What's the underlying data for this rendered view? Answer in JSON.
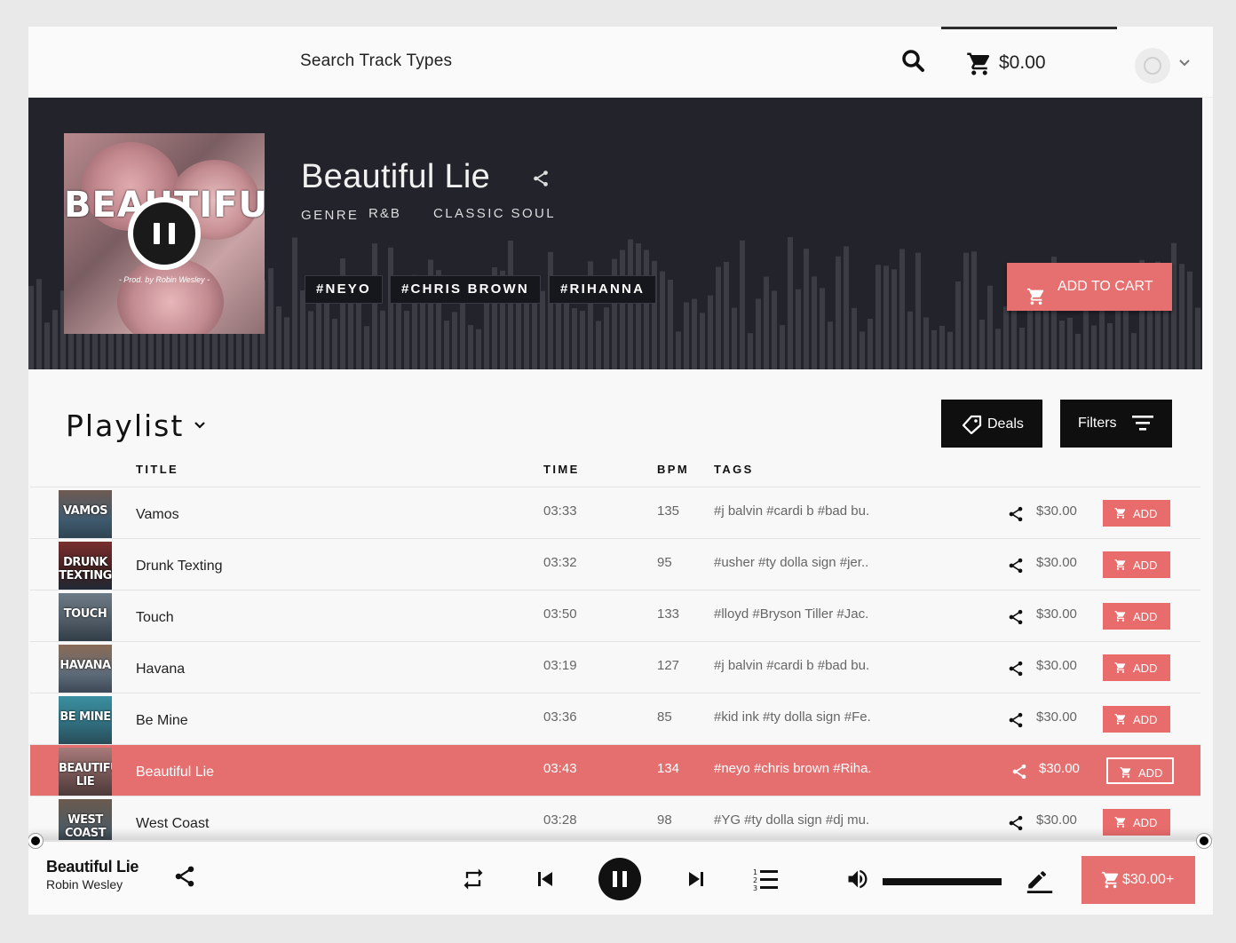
{
  "header": {
    "search_label": "Search Track Types",
    "cart_total": "$0.00"
  },
  "hero": {
    "title": "Beautiful Lie",
    "genre_label": "GENRE",
    "genre_value": "R&B",
    "genre_sub": "CLASSIC SOUL",
    "cover_title": "BEAUTIFUL",
    "cover_credit": "- Prod. by Robin Wesley -",
    "tags": [
      "#NEYO",
      "#CHRIS BROWN",
      "#RIHANNA"
    ],
    "add_to_cart": "ADD TO CART"
  },
  "playlist": {
    "title": "Playlist",
    "deals_label": "Deals",
    "filters_label": "Filters",
    "columns": {
      "title": "TITLE",
      "time": "TIME",
      "bpm": "BPM",
      "tags": "TAGS"
    },
    "add_label": "ADD",
    "tracks": [
      {
        "cover_text": "VAMOS",
        "title": "Vamos",
        "time": "03:33",
        "bpm": "135",
        "tags": "#j balvin  #cardi b  #bad bu.",
        "price": "$30.00"
      },
      {
        "cover_text": "DRUNK TEXTING",
        "title": "Drunk Texting",
        "time": "03:32",
        "bpm": "95",
        "tags": "#usher  #ty dolla sign  #jer..",
        "price": "$30.00"
      },
      {
        "cover_text": "TOUCH",
        "title": "Touch",
        "time": "03:50",
        "bpm": "133",
        "tags": "#lloyd  #Bryson Tiller  #Jac.",
        "price": "$30.00"
      },
      {
        "cover_text": "HAVANA",
        "title": "Havana",
        "time": "03:19",
        "bpm": "127",
        "tags": "#j balvin  #cardi b  #bad bu.",
        "price": "$30.00"
      },
      {
        "cover_text": "BE MINE",
        "title": "Be Mine",
        "time": "03:36",
        "bpm": "85",
        "tags": "#kid ink  #ty dolla sign  #Fe.",
        "price": "$30.00"
      },
      {
        "cover_text": "BEAUTIFUL LIE",
        "title": "Beautiful Lie",
        "time": "03:43",
        "bpm": "134",
        "tags": "#neyo  #chris brown  #Riha.",
        "price": "$30.00"
      },
      {
        "cover_text": "WEST COAST",
        "title": "West Coast",
        "time": "03:28",
        "bpm": "98",
        "tags": "#YG  #ty dolla sign  #dj mu.",
        "price": "$30.00"
      }
    ]
  },
  "player": {
    "title": "Beautiful Lie",
    "artist": "Robin Wesley",
    "checkout_label": "$30.00+"
  },
  "colors": {
    "accent": "#e66f6f",
    "hero_bg": "#22232b",
    "dark_button": "#0f0f0f"
  }
}
